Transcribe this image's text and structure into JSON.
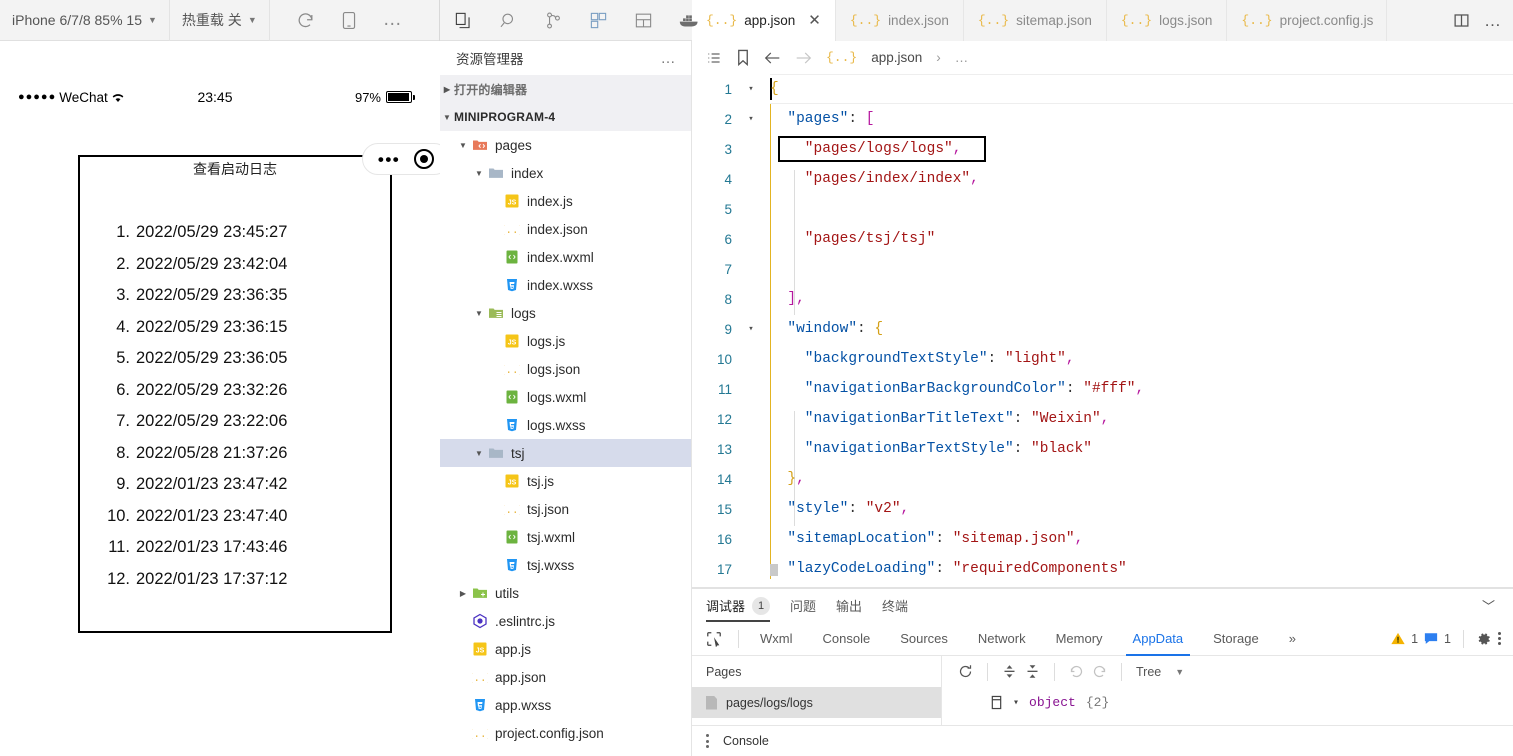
{
  "simulator": {
    "toolbar": {
      "device": "iPhone 6/7/8 85% 15",
      "hot_reload": "热重载 关",
      "icons": [
        "refresh-icon",
        "device-icon",
        "more-icon"
      ]
    },
    "status_bar": {
      "carrier_dots": "●●●●●",
      "carrier": "WeChat",
      "wifi": "wifi-icon",
      "time": "23:45",
      "battery_percent": "97%"
    },
    "page": {
      "title": "查看启动日志",
      "capsule": {
        "dots": "•••",
        "target": "target-icon"
      },
      "logs": [
        {
          "index": "1.",
          "time": "2022/05/29 23:45:27"
        },
        {
          "index": "2.",
          "time": "2022/05/29 23:42:04"
        },
        {
          "index": "3.",
          "time": "2022/05/29 23:36:35"
        },
        {
          "index": "4.",
          "time": "2022/05/29 23:36:15"
        },
        {
          "index": "5.",
          "time": "2022/05/29 23:36:05"
        },
        {
          "index": "6.",
          "time": "2022/05/29 23:32:26"
        },
        {
          "index": "7.",
          "time": "2022/05/29 23:22:06"
        },
        {
          "index": "8.",
          "time": "2022/05/28 21:37:26"
        },
        {
          "index": "9.",
          "time": "2022/01/23 23:47:42"
        },
        {
          "index": "10.",
          "time": "2022/01/23 23:47:40"
        },
        {
          "index": "11.",
          "time": "2022/01/23 17:43:46"
        },
        {
          "index": "12.",
          "time": "2022/01/23 17:37:12"
        }
      ]
    }
  },
  "activity_bar": {
    "items": [
      "files-icon",
      "search-icon",
      "source-control-icon",
      "extensions-icon",
      "layout-icon",
      "docker-icon"
    ]
  },
  "explorer": {
    "title": "资源管理器",
    "more": "…",
    "open_editors": "打开的编辑器",
    "project": "MINIPROGRAM-4",
    "tree": [
      {
        "label": "pages",
        "type": "folder",
        "depth": 1,
        "expanded": true,
        "icon": "folder-pages-icon"
      },
      {
        "label": "index",
        "type": "folder",
        "depth": 2,
        "expanded": true,
        "icon": "folder-icon"
      },
      {
        "label": "index.js",
        "type": "js",
        "depth": 3
      },
      {
        "label": "index.json",
        "type": "json",
        "depth": 3
      },
      {
        "label": "index.wxml",
        "type": "wxml",
        "depth": 3
      },
      {
        "label": "index.wxss",
        "type": "wxss",
        "depth": 3
      },
      {
        "label": "logs",
        "type": "folder",
        "depth": 2,
        "expanded": true,
        "icon": "folder-logs-icon"
      },
      {
        "label": "logs.js",
        "type": "js",
        "depth": 3
      },
      {
        "label": "logs.json",
        "type": "json",
        "depth": 3
      },
      {
        "label": "logs.wxml",
        "type": "wxml",
        "depth": 3
      },
      {
        "label": "logs.wxss",
        "type": "wxss",
        "depth": 3
      },
      {
        "label": "tsj",
        "type": "folder",
        "depth": 2,
        "expanded": true,
        "selected": true,
        "icon": "folder-icon"
      },
      {
        "label": "tsj.js",
        "type": "js",
        "depth": 3
      },
      {
        "label": "tsj.json",
        "type": "json",
        "depth": 3
      },
      {
        "label": "tsj.wxml",
        "type": "wxml",
        "depth": 3
      },
      {
        "label": "tsj.wxss",
        "type": "wxss",
        "depth": 3
      },
      {
        "label": "utils",
        "type": "folder",
        "depth": 1,
        "expanded": false,
        "icon": "folder-utils-icon"
      },
      {
        "label": ".eslintrc.js",
        "type": "eslint",
        "depth": 1
      },
      {
        "label": "app.js",
        "type": "js",
        "depth": 1
      },
      {
        "label": "app.json",
        "type": "json",
        "depth": 1
      },
      {
        "label": "app.wxss",
        "type": "wxss",
        "depth": 1
      },
      {
        "label": "project.config.json",
        "type": "json",
        "depth": 1
      }
    ]
  },
  "editor": {
    "tabs": [
      {
        "label": "app.json",
        "active": true,
        "closable": true
      },
      {
        "label": "index.json",
        "active": false
      },
      {
        "label": "sitemap.json",
        "active": false
      },
      {
        "label": "logs.json",
        "active": false
      },
      {
        "label": "project.config.js",
        "active": false
      }
    ],
    "split_icon": "split-editor-icon",
    "breadcrumb": {
      "file": "app.json",
      "sep": "›",
      "rest": "…"
    },
    "breadcrumb_icons": [
      "outline-icon",
      "bookmark-icon",
      "back-arrow-icon",
      "forward-arrow-icon"
    ],
    "lines": [
      {
        "n": "1",
        "fold": "▾",
        "tokens": [
          {
            "t": "{",
            "c": "brace"
          }
        ]
      },
      {
        "n": "2",
        "fold": "▾",
        "tokens": [
          {
            "t": "  \"pages\"",
            "c": "key"
          },
          {
            "t": ": ",
            "c": "plain"
          },
          {
            "t": "[",
            "c": "punc"
          }
        ]
      },
      {
        "n": "3",
        "fold": "",
        "tokens": [
          {
            "t": "    \"pages/logs/logs\"",
            "c": "str"
          },
          {
            "t": ",",
            "c": "punc"
          }
        ],
        "boxed": true
      },
      {
        "n": "4",
        "fold": "",
        "tokens": [
          {
            "t": "    \"pages/index/index\"",
            "c": "str"
          },
          {
            "t": ",",
            "c": "punc"
          }
        ]
      },
      {
        "n": "5",
        "fold": "",
        "tokens": []
      },
      {
        "n": "6",
        "fold": "",
        "tokens": [
          {
            "t": "    \"pages/tsj/tsj\"",
            "c": "str"
          }
        ]
      },
      {
        "n": "7",
        "fold": "",
        "tokens": []
      },
      {
        "n": "8",
        "fold": "",
        "tokens": [
          {
            "t": "  ]",
            "c": "punc"
          },
          {
            "t": ",",
            "c": "punc"
          }
        ]
      },
      {
        "n": "9",
        "fold": "▾",
        "tokens": [
          {
            "t": "  \"window\"",
            "c": "key"
          },
          {
            "t": ": ",
            "c": "plain"
          },
          {
            "t": "{",
            "c": "brace"
          }
        ]
      },
      {
        "n": "10",
        "fold": "",
        "tokens": [
          {
            "t": "    \"backgroundTextStyle\"",
            "c": "key"
          },
          {
            "t": ": ",
            "c": "plain"
          },
          {
            "t": "\"light\"",
            "c": "str"
          },
          {
            "t": ",",
            "c": "punc"
          }
        ]
      },
      {
        "n": "11",
        "fold": "",
        "tokens": [
          {
            "t": "    \"navigationBarBackgroundColor\"",
            "c": "key"
          },
          {
            "t": ": ",
            "c": "plain"
          },
          {
            "t": "\"#fff\"",
            "c": "str"
          },
          {
            "t": ",",
            "c": "punc"
          }
        ]
      },
      {
        "n": "12",
        "fold": "",
        "tokens": [
          {
            "t": "    \"navigationBarTitleText\"",
            "c": "key"
          },
          {
            "t": ": ",
            "c": "plain"
          },
          {
            "t": "\"Weixin\"",
            "c": "str"
          },
          {
            "t": ",",
            "c": "punc"
          }
        ]
      },
      {
        "n": "13",
        "fold": "",
        "tokens": [
          {
            "t": "    \"navigationBarTextStyle\"",
            "c": "key"
          },
          {
            "t": ": ",
            "c": "plain"
          },
          {
            "t": "\"black\"",
            "c": "str"
          }
        ]
      },
      {
        "n": "14",
        "fold": "",
        "tokens": [
          {
            "t": "  }",
            "c": "brace"
          },
          {
            "t": ",",
            "c": "punc"
          }
        ]
      },
      {
        "n": "15",
        "fold": "",
        "tokens": [
          {
            "t": "  \"style\"",
            "c": "key"
          },
          {
            "t": ": ",
            "c": "plain"
          },
          {
            "t": "\"v2\"",
            "c": "str"
          },
          {
            "t": ",",
            "c": "punc"
          }
        ]
      },
      {
        "n": "16",
        "fold": "",
        "tokens": [
          {
            "t": "  \"sitemapLocation\"",
            "c": "key"
          },
          {
            "t": ": ",
            "c": "plain"
          },
          {
            "t": "\"sitemap.json\"",
            "c": "str"
          },
          {
            "t": ",",
            "c": "punc"
          }
        ]
      },
      {
        "n": "17",
        "fold": "",
        "tokens": [
          {
            "t": "  \"lazyCodeLoading\"",
            "c": "key"
          },
          {
            "t": ": ",
            "c": "plain"
          },
          {
            "t": "\"requiredComponents\"",
            "c": "str"
          }
        ]
      }
    ]
  },
  "panel": {
    "tabs": [
      {
        "label": "调试器",
        "badge": "1",
        "active": true
      },
      {
        "label": "问题",
        "active": false
      },
      {
        "label": "输出",
        "active": false
      },
      {
        "label": "终端",
        "active": false
      }
    ],
    "collapse_icon": "chevron-up-icon",
    "devtools_tabs": [
      {
        "label": "Wxml",
        "active": false
      },
      {
        "label": "Console",
        "active": false
      },
      {
        "label": "Sources",
        "active": false
      },
      {
        "label": "Network",
        "active": false
      },
      {
        "label": "Memory",
        "active": false
      },
      {
        "label": "AppData",
        "active": true
      },
      {
        "label": "Storage",
        "active": false
      }
    ],
    "overflow": "»",
    "warning_count": "1",
    "message_count": "1",
    "settings_icon": "gear-icon",
    "kebab_icon": "kebab-menu-icon",
    "inspect_icon": "inspect-element-icon",
    "appdata": {
      "pages_header": "Pages",
      "page_item": "pages/logs/logs",
      "toolbar_icons": [
        "refresh-icon",
        "expand-all-icon",
        "collapse-all-icon",
        "undo-icon",
        "redo-icon"
      ],
      "view_mode": "Tree",
      "object_label": "object",
      "object_count": "{2}",
      "object_caret": "▾"
    },
    "console_label": "Console"
  },
  "colors": {
    "accent_blue": "#1a73e8",
    "json_yellow": "#e9b949",
    "string_red": "#a31515",
    "key_blue": "#0451a5",
    "line_number": "#237893",
    "warning": "#f5b300"
  }
}
